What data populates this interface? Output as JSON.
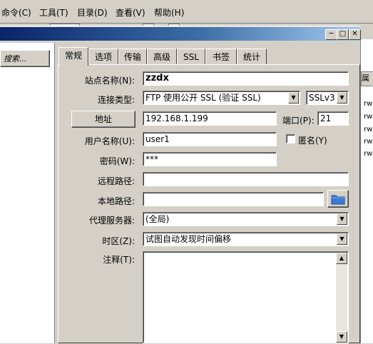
{
  "menubar": {
    "items": [
      "命令(C)",
      "工具(T)",
      "目录(D)",
      "查看(V)",
      "帮助(H)"
    ]
  },
  "dialog": {
    "left_button": "搜索...",
    "tabs": [
      "常规",
      "选项",
      "传输",
      "高级",
      "SSL",
      "书签",
      "统计"
    ],
    "active_tab": "常规",
    "form": {
      "site_name_label": "站点名称(N):",
      "site_name_value": "zzdx",
      "connection_type_label": "连接类型:",
      "connection_type_value": "FTP 使用公开 SSL (验证 SSL)",
      "ssl_version_value": "SSLv3",
      "address_button": "地址",
      "address_value": "192.168.1.199",
      "port_label": "端口(P):",
      "port_value": "21",
      "username_label": "用户名称(U):",
      "username_value": "user1",
      "anonymous_label": "匿名(Y)",
      "password_label": "密码(W):",
      "password_value": "***",
      "remote_path_label": "远程路径:",
      "remote_path_value": "",
      "local_path_label": "本地路径:",
      "local_path_value": "",
      "proxy_label": "代理服务器:",
      "proxy_value": "(全局)",
      "timezone_label": "时区(Z):",
      "timezone_value": "试图自动发现时间偏移",
      "notes_label": "注释(T):",
      "notes_value": ""
    }
  },
  "background_panel": {
    "header": "属性",
    "rows": [
      "rw",
      "rw",
      "rw",
      "rw",
      "rw"
    ]
  },
  "colors": {
    "face": "#d4d0c8",
    "titlebar_start": "#0a246a",
    "titlebar_end": "#a6caf0",
    "folder_icon": "#3a7bd5"
  },
  "icons": {
    "minimize": "minimize-icon",
    "maximize": "maximize-icon",
    "close": "close-icon",
    "browse_folder": "folder-icon",
    "dropdown": "chevron-down-icon"
  }
}
